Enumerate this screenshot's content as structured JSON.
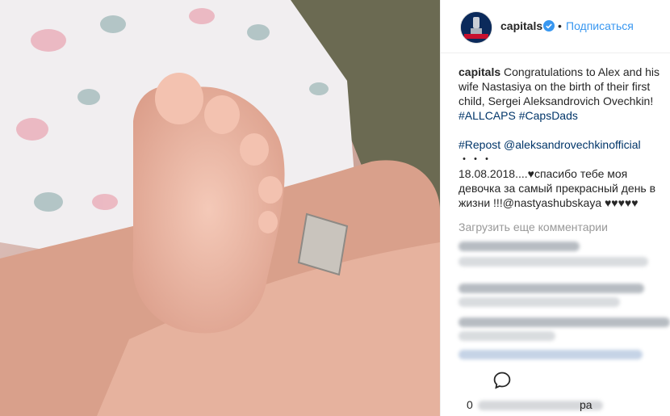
{
  "post": {
    "username": "capitals",
    "dot": "•",
    "follow_label": "Подписаться",
    "avatar_text": "CHAMPIONS"
  },
  "caption": {
    "username": "capitals",
    "text": "Congratulations to Alex and his wife Nastasiya on the birth of their first child, Sergei Aleksandrovich Ovechkin!",
    "hashtag1": "#ALLCAPS",
    "hashtag2": "#CapsDads",
    "repost_tag": "#Repost",
    "repost_user": "@aleksandrovechkinofficial",
    "dots": "・・・",
    "date_line": "18.08.2018....♥спасибо тебе моя девочка за самый прекрасный день в жизни !!!@nastyashubskaya ♥♥♥♥♥"
  },
  "comments": {
    "load_more": "Загрузить еще комментарии"
  },
  "footer": {
    "likes_prefix": "0",
    "likes_suffix": "ра"
  },
  "colors": {
    "link": "#3897f0",
    "hashtag": "#003569",
    "text": "#262626",
    "muted": "#999999"
  },
  "icons": {
    "verified": "verified-badge-icon",
    "comment": "comment-icon"
  }
}
